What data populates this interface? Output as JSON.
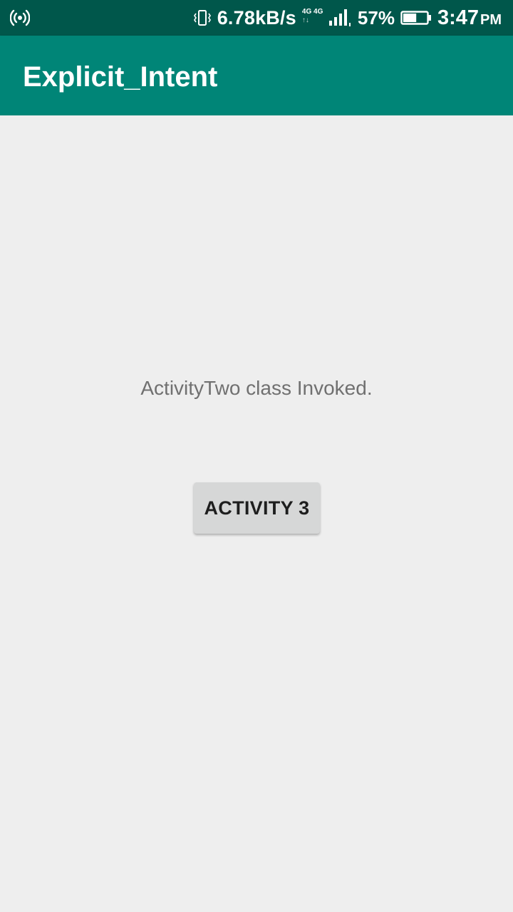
{
  "status_bar": {
    "hotspot_icon": "hotspot-icon",
    "vibrate_icon": "vibrate-icon",
    "net_speed": "6.78kB/s",
    "net_type": "4G 4G",
    "signal_icon": "signal-icon",
    "battery_percent": "57%",
    "battery_level": 0.57,
    "battery_icon": "battery-icon",
    "time": "3:47",
    "ampm": "PM",
    "background": "#00574b"
  },
  "app_bar": {
    "title": "Explicit_Intent",
    "background": "#008577"
  },
  "main": {
    "message": "ActivityTwo class Invoked.",
    "button_label": "ACTIVITY 3",
    "background": "#eeeeee"
  }
}
